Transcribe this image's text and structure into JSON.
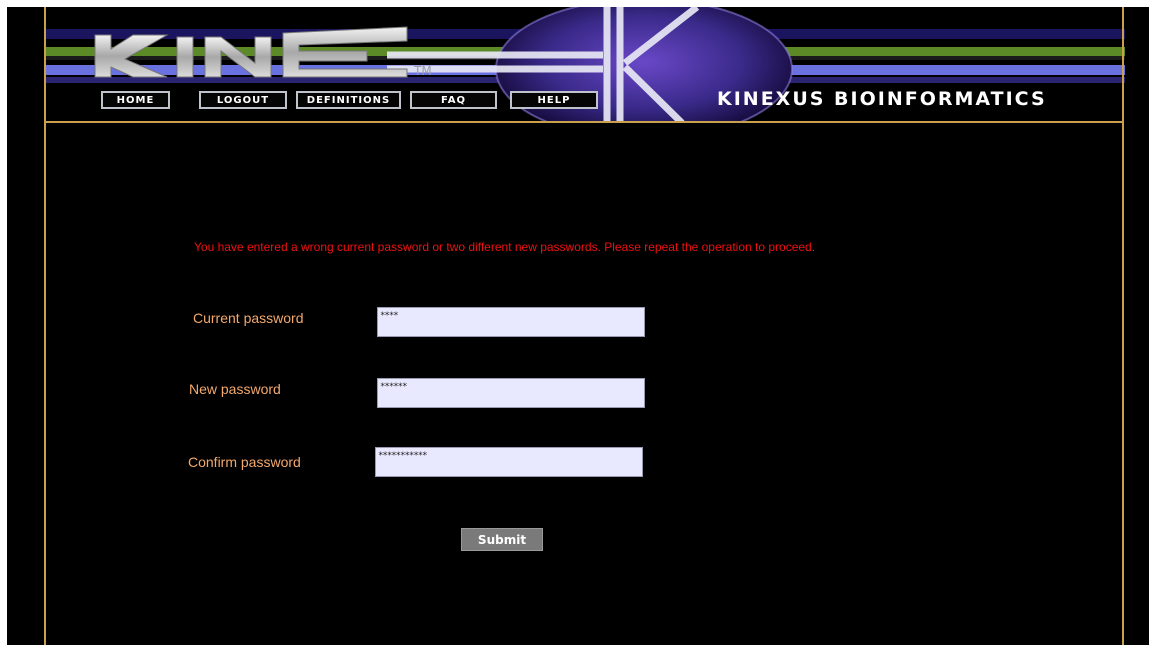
{
  "header": {
    "logo_text": "KINET",
    "trademark": "TM",
    "brand": "KINEXUS BIOINFORMATICS",
    "nav": [
      {
        "label": "HOME"
      },
      {
        "label": "LOGOUT"
      },
      {
        "label": "DEFINITIONS"
      },
      {
        "label": "FAQ"
      },
      {
        "label": "HELP"
      }
    ]
  },
  "form": {
    "error_message": "You have entered a wrong current password or two different new passwords. Please repeat the operation to proceed.",
    "fields": [
      {
        "label": "Current password",
        "value": "****"
      },
      {
        "label": "New password",
        "value": "******"
      },
      {
        "label": "Confirm password",
        "value": "***********"
      }
    ],
    "submit_label": "Submit"
  },
  "colors": {
    "background": "#000000",
    "border_gold": "#c9a04b",
    "label_orange": "#f3a86c",
    "error_red": "#ee1111",
    "input_bg": "#e8e8ff",
    "button_gray": "#7a7a7a"
  }
}
